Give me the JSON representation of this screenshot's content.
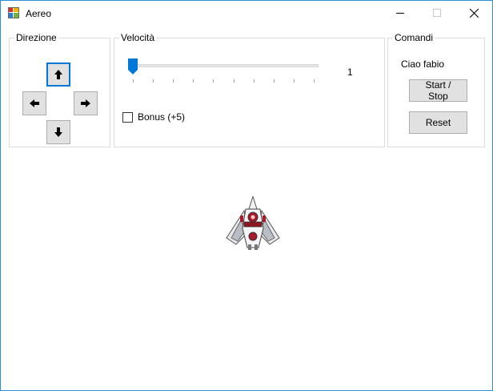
{
  "window": {
    "title": "Aereo",
    "icons": {
      "app": "app-icon",
      "minimize": "minimize-icon",
      "maximize": "maximize-icon",
      "close": "close-icon"
    }
  },
  "direction": {
    "legend": "Direzione",
    "buttons": [
      {
        "name": "up",
        "icon": "arrow-up-icon",
        "focused": true
      },
      {
        "name": "left",
        "icon": "arrow-left-icon",
        "focused": false
      },
      {
        "name": "right",
        "icon": "arrow-right-icon",
        "focused": false
      },
      {
        "name": "down",
        "icon": "arrow-down-icon",
        "focused": false
      }
    ]
  },
  "speed": {
    "legend": "Velocità",
    "slider": {
      "value": 1,
      "min": 1,
      "max": 10,
      "tick_count": 10
    },
    "value_label": "1",
    "bonus": {
      "label": "Bonus (+5)",
      "checked": false
    }
  },
  "commands": {
    "legend": "Comandi",
    "greeting": "Ciao fabio",
    "start_stop_label": "Start / Stop",
    "reset_label": "Reset"
  },
  "canvas": {
    "sprite": "spaceship-icon"
  },
  "colors": {
    "accent": "#0078d7",
    "button_face": "#e1e1e1",
    "button_border": "#adadad",
    "group_border": "#dcdcdc"
  }
}
